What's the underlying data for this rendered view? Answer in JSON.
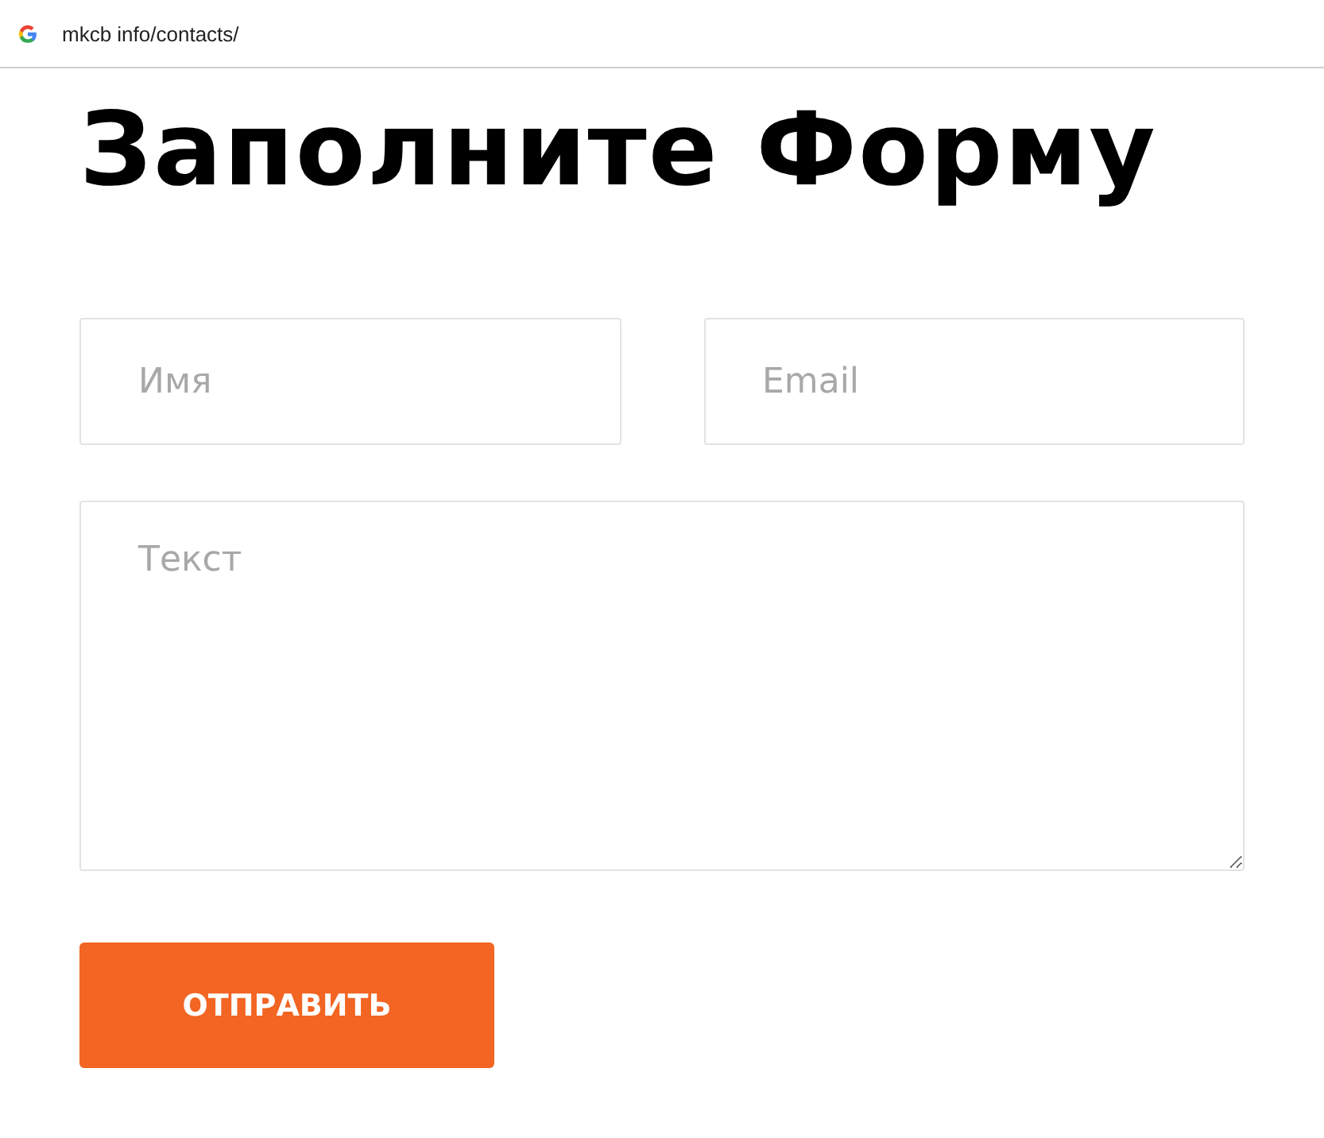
{
  "address_bar": {
    "url": "mkcb info/contacts/"
  },
  "form": {
    "title": "Заполните Форму",
    "fields": [
      {
        "placeholder": "Имя"
      },
      {
        "placeholder": "Email"
      }
    ],
    "message": {
      "placeholder": "Текст"
    },
    "submit": "ОТПРАВИТЬ"
  }
}
